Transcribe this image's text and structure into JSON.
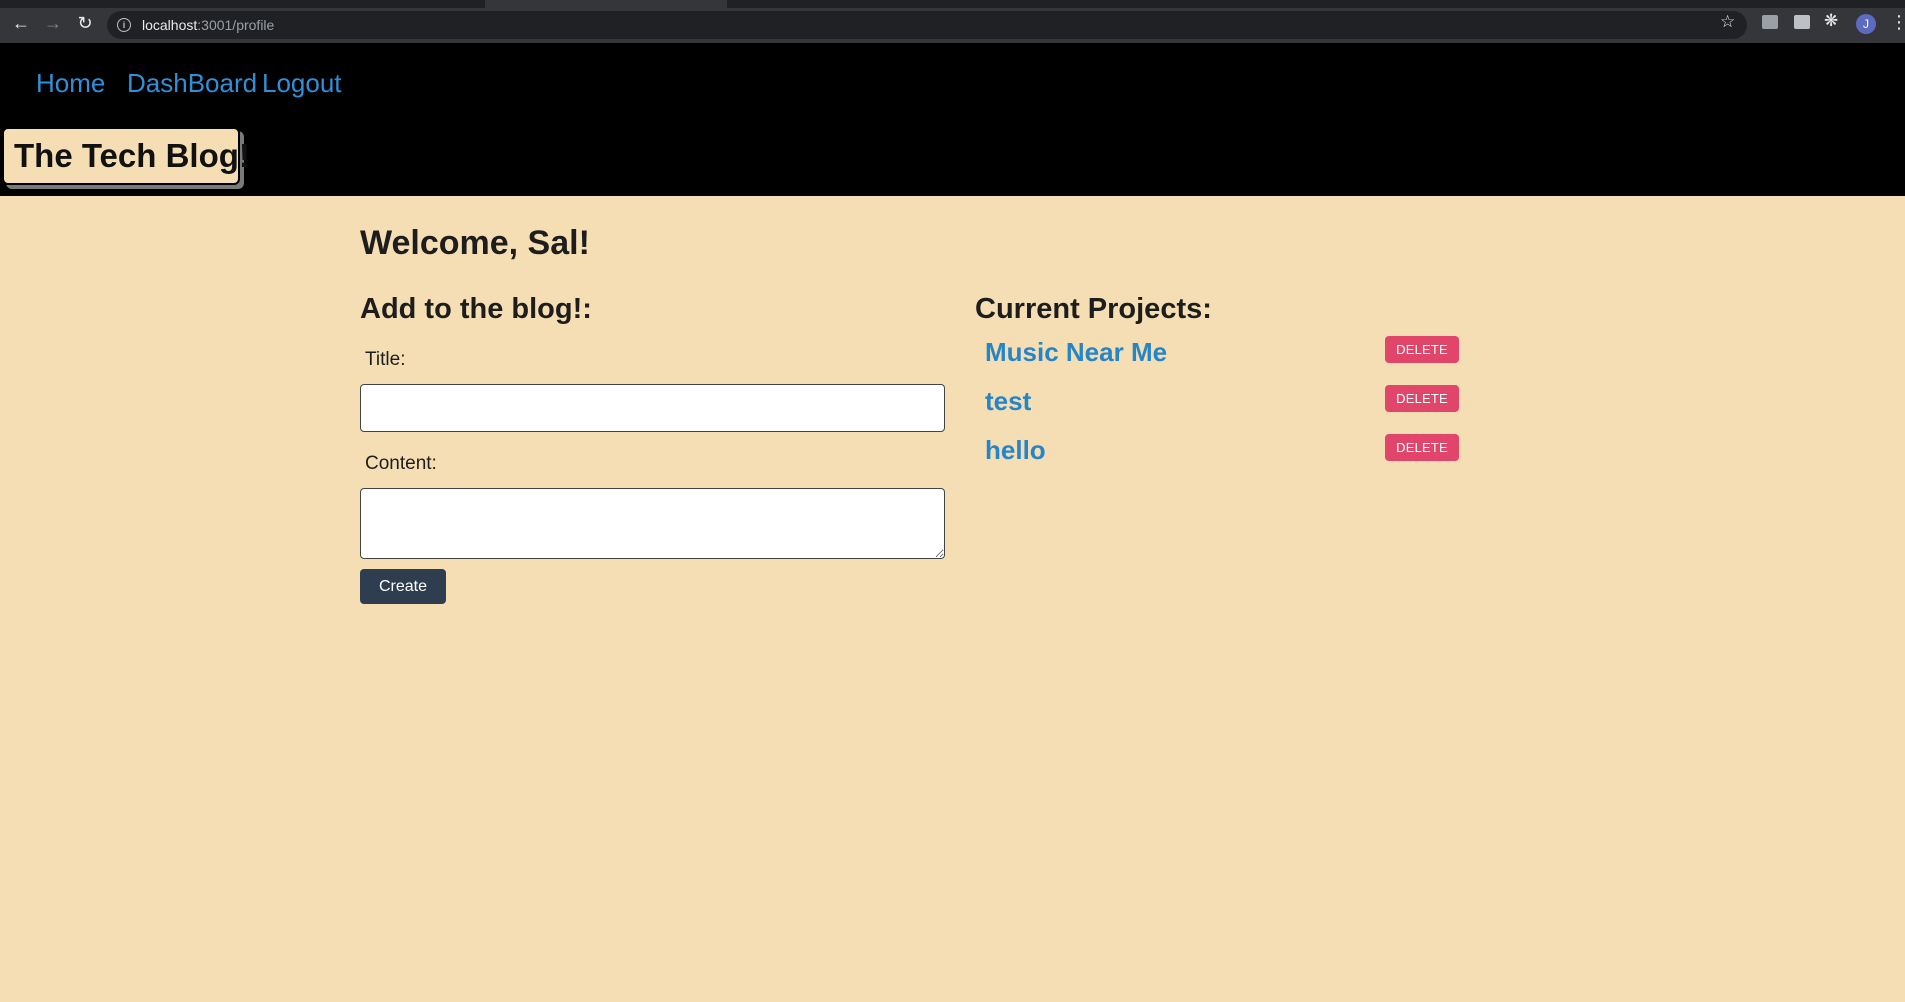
{
  "browser": {
    "url_host": "localhost",
    "url_path": ":3001/profile",
    "avatar_initial": "J"
  },
  "nav": {
    "links": [
      {
        "label": "Home"
      },
      {
        "label": "DashBoard"
      },
      {
        "label": "Logout"
      }
    ]
  },
  "brand": {
    "title": "The Tech Blog!"
  },
  "main": {
    "welcome": "Welcome, Sal!",
    "form": {
      "heading": "Add to the blog!:",
      "title_label": "Title:",
      "title_value": "",
      "content_label": "Content:",
      "content_value": "",
      "submit_label": "Create"
    },
    "projects": {
      "heading": "Current Projects:",
      "delete_label": "DELETE",
      "items": [
        {
          "name": "Music Near Me"
        },
        {
          "name": "test"
        },
        {
          "name": "hello"
        }
      ]
    }
  },
  "colors": {
    "page_background": "#f5deb3",
    "header_background": "#000000",
    "link": "#2f8fd8",
    "delete_button": "#e2456a",
    "create_button": "#2e3e50"
  }
}
